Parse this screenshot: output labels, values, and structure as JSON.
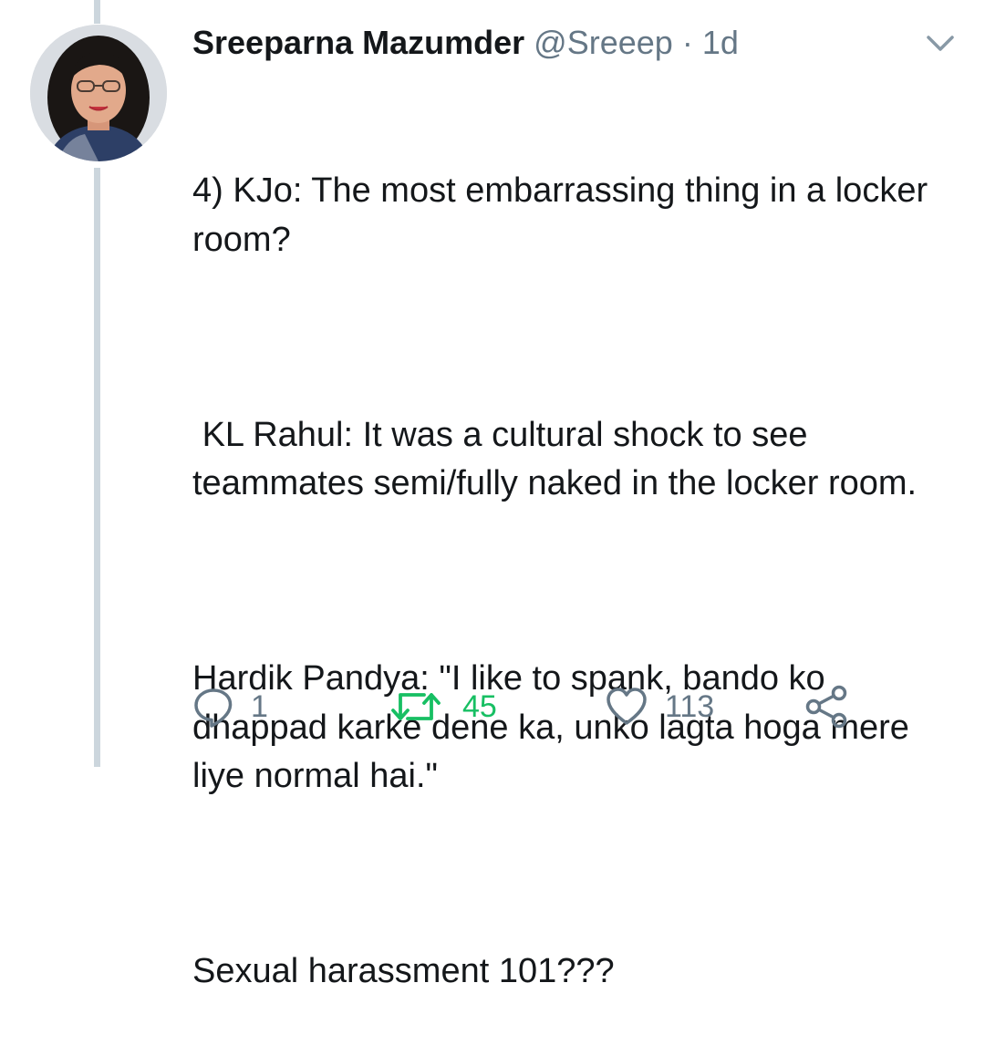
{
  "tweet": {
    "author_name": "Sreeparna Mazumder",
    "handle": "@Sreeep",
    "separator": "·",
    "time": "1d",
    "paragraphs": [
      "4) KJo: The most embarrassing thing in a locker room?",
      " KL Rahul: It was a cultural shock to see teammates semi/fully naked in the locker room.",
      "Hardik Pandya: \"I like to spank, bando ko dhappad karke dene ka, unko lagta hoga mere liye normal hai.\"",
      "Sexual harassment 101???"
    ]
  },
  "actions": {
    "reply_count": "1",
    "retweet_count": "45",
    "like_count": "113"
  },
  "icons": {
    "reply": "reply-icon",
    "retweet": "retweet-icon",
    "like": "heart-icon",
    "share": "share-icon",
    "menu": "chevron-down-icon"
  },
  "colors": {
    "text": "#14171a",
    "muted": "#657786",
    "retweet_active": "#17bf63",
    "thread_line": "#ccd6dd"
  }
}
